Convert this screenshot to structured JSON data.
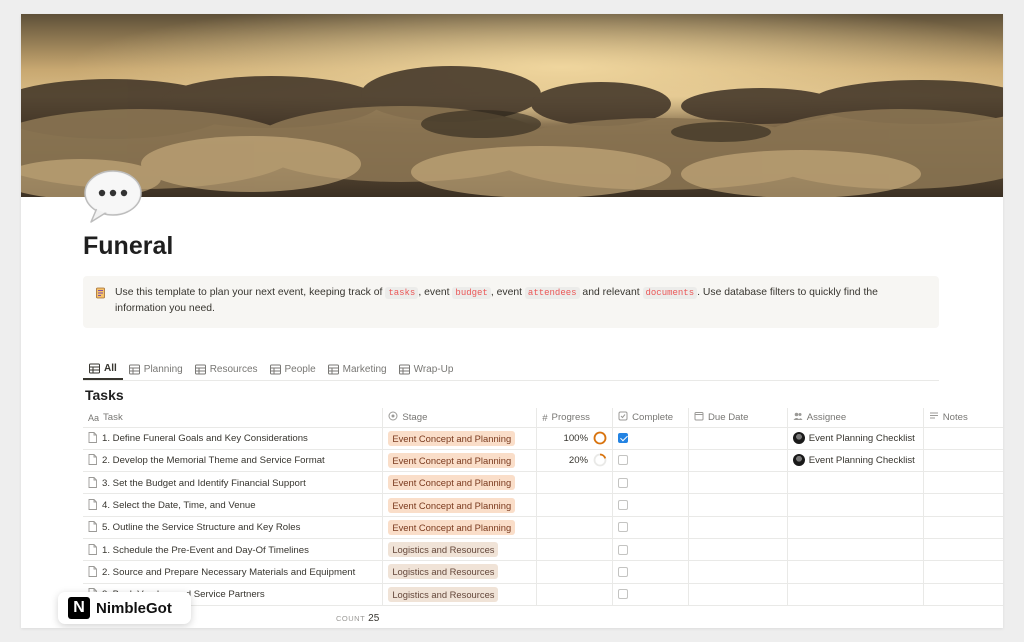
{
  "page": {
    "title": "Funeral",
    "emoji_icon": "speech-bubble-icon"
  },
  "callout": {
    "icon": "page-facing-up-icon",
    "part1": "Use this template to plan your next event, keeping track of ",
    "code1": "tasks",
    "part2": ", event ",
    "code2": "budget",
    "part3": ", event ",
    "code3": "attendees",
    "part4": " and relevant ",
    "code4": "documents",
    "part5": ". Use database filters to quickly find the information you need."
  },
  "tabs": [
    {
      "label": "All",
      "active": true
    },
    {
      "label": "Planning"
    },
    {
      "label": "Resources"
    },
    {
      "label": "People"
    },
    {
      "label": "Marketing"
    },
    {
      "label": "Wrap-Up"
    }
  ],
  "database": {
    "title": "Tasks",
    "columns": {
      "task": "Task",
      "stage": "Stage",
      "progress": "Progress",
      "complete": "Complete",
      "due": "Due Date",
      "assignee": "Assignee",
      "notes": "Notes"
    },
    "rows": [
      {
        "task": "1. Define Funeral Goals and Key Considerations",
        "stage": "Event Concept and Planning",
        "progress": "100%",
        "progress_value": 1.0,
        "complete": true,
        "assignee": "Event Planning Checklist"
      },
      {
        "task": "2. Develop the Memorial Theme and Service Format",
        "stage": "Event Concept and Planning",
        "progress": "20%",
        "progress_value": 0.2,
        "complete": false,
        "assignee": "Event Planning Checklist"
      },
      {
        "task": "3. Set the Budget and Identify Financial Support",
        "stage": "Event Concept and Planning",
        "progress": "",
        "complete": false,
        "assignee": ""
      },
      {
        "task": "4. Select the Date, Time, and Venue",
        "stage": "Event Concept and Planning",
        "progress": "",
        "complete": false,
        "assignee": ""
      },
      {
        "task": "5. Outline the Service Structure and Key Roles",
        "stage": "Event Concept and Planning",
        "progress": "",
        "complete": false,
        "assignee": ""
      },
      {
        "task": "1. Schedule the Pre-Event and Day-Of Timelines",
        "stage": "Logistics and Resources",
        "progress": "",
        "complete": false,
        "assignee": ""
      },
      {
        "task": "2. Source and Prepare Necessary Materials and Equipment",
        "stage": "Logistics and Resources",
        "progress": "",
        "complete": false,
        "assignee": ""
      },
      {
        "task": "3. Book Vendors and Service Partners",
        "stage": "Logistics and Resources",
        "progress": "",
        "complete": false,
        "assignee": ""
      }
    ],
    "count_label": "COUNT",
    "count_value": "25"
  },
  "brand": {
    "letter": "N",
    "name": "NimbleGot"
  },
  "colors": {
    "tag_concept_bg": "#fadec9",
    "tag_logistics_bg": "#f0e3d7",
    "checkbox_checked": "#2383e2",
    "progress_ring": "#d9730d"
  }
}
